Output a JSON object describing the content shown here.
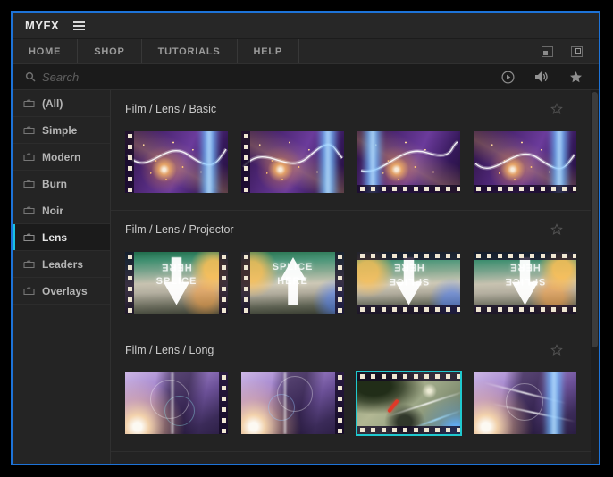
{
  "titlebar": {
    "app_name": "MYFX"
  },
  "nav": {
    "tabs": [
      "HOME",
      "SHOP",
      "TUTORIALS",
      "HELP"
    ]
  },
  "search": {
    "placeholder": "Search"
  },
  "sidebar": {
    "items": [
      {
        "label": "(All)",
        "selected": false
      },
      {
        "label": "Simple",
        "selected": false
      },
      {
        "label": "Modern",
        "selected": false
      },
      {
        "label": "Burn",
        "selected": false
      },
      {
        "label": "Noir",
        "selected": false
      },
      {
        "label": "Lens",
        "selected": true
      },
      {
        "label": "Leaders",
        "selected": false
      },
      {
        "label": "Overlays",
        "selected": false
      }
    ]
  },
  "content": {
    "sections": [
      {
        "title": "Film / Lens / Basic",
        "favorited": false,
        "thumbnail_count": 4
      },
      {
        "title": "Film / Lens / Projector",
        "favorited": false,
        "thumbnail_count": 4,
        "splice_top": "SPLICE",
        "splice_bottom": "HERE"
      },
      {
        "title": "Film / Lens / Long",
        "favorited": false,
        "thumbnail_count": 4,
        "selected_thumbnail_index": 2
      }
    ]
  },
  "colors": {
    "window_border": "#1d73d8",
    "sidebar_accent": "#17c1e4",
    "thumbnail_selection": "#1fc9cf",
    "background": "#242424"
  }
}
